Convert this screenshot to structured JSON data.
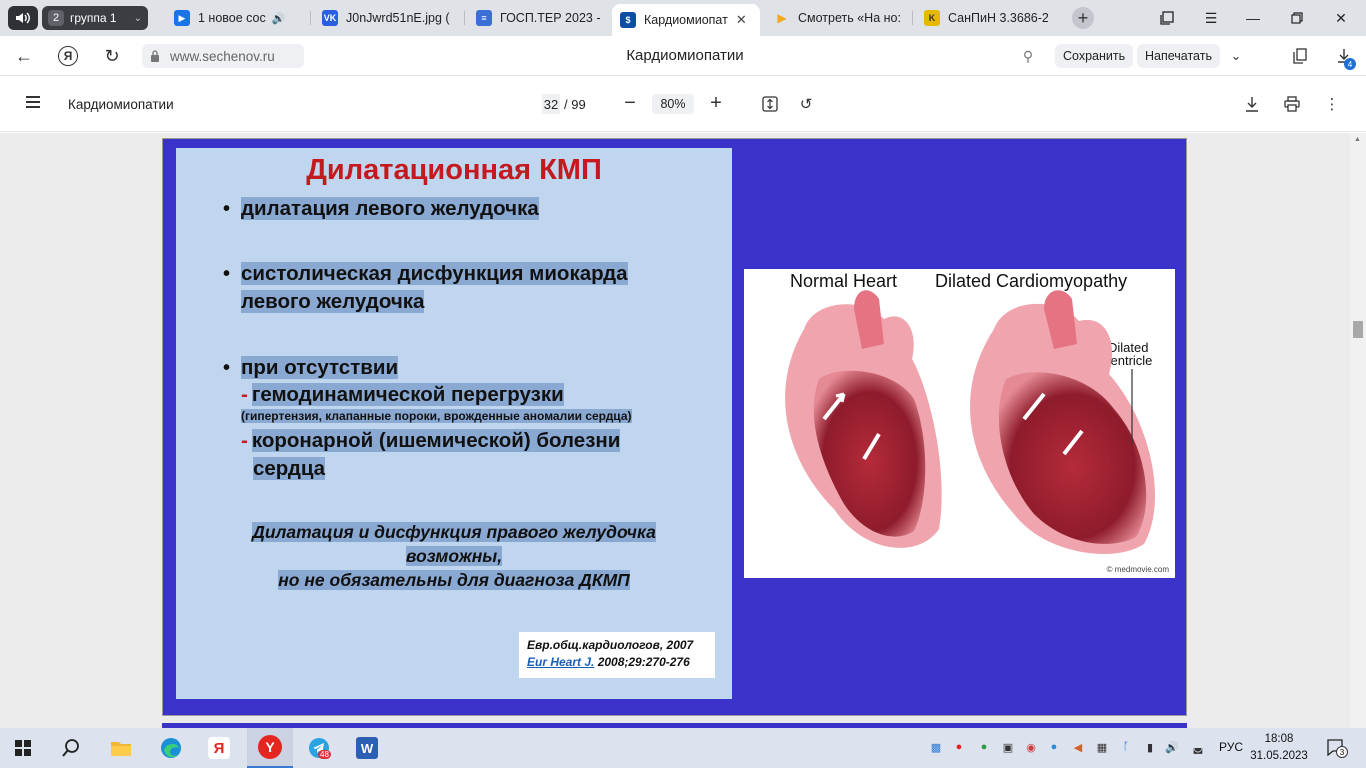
{
  "tabs": {
    "group": {
      "count": "2",
      "label": "группа 1"
    },
    "items": [
      {
        "title": "1 новое сос",
        "color": "#1a73e8"
      },
      {
        "title": "J0nJwrd51nE.jpg (",
        "color": "#2a5fe0"
      },
      {
        "title": "ГОСП.ТЕР 2023 - (",
        "color": "#3b6fd6"
      },
      {
        "title": "Кардиомиопат",
        "color": "#0b4ea2"
      },
      {
        "title": "Смотреть «На но:",
        "color": "#f4a71d"
      },
      {
        "title": "СанПиН 3.3686-2",
        "color": "#e5b900"
      }
    ]
  },
  "address": {
    "url": "www.sechenov.ru",
    "title": "Кардиомиопатии",
    "save_label": "Сохранить",
    "print_label": "Напечатать",
    "download_badge": "4",
    "yandex_glyph": "Я"
  },
  "pdf": {
    "title": "Кардиомиопатии",
    "page": "32",
    "total": "/ 99",
    "zoom": "80%"
  },
  "slide": {
    "heading": "Дилатационная КМП",
    "bullet1": "дилатация левого желудочка",
    "bullet2_line1": "систолическая дисфункция миокарда",
    "bullet2_line2": "левого желудочка",
    "bullet3": "при отсутствии",
    "sub1": "гемодинамической перегрузки",
    "sub1_note": "(гипертензия, клапанные пороки, врожденные аномалии сердца)",
    "sub2_line1": "коронарной (ишемической) болезни",
    "sub2_line2": "сердца",
    "italic_line1": "Дилатация и дисфункция правого желудочка",
    "italic_line2": "возможны,",
    "italic_line3": "но не обязательны для диагноза ДКМП",
    "ref_line1": "Евр.общ.кардиологов, 2007",
    "ref_link": "Eur Heart J.",
    "ref_rest": " 2008;29:270-276",
    "image_label_left": "Normal Heart",
    "image_label_right": "Dilated Cardiomyopathy",
    "image_label_dilated1": "Dilated",
    "image_label_dilated2": "ventricle",
    "image_copyright": "© medmovie.com"
  },
  "taskbar": {
    "language": "РУС",
    "time": "18:08",
    "date": "31.05.2023",
    "notifications": "3",
    "telegram_badge": "48"
  }
}
